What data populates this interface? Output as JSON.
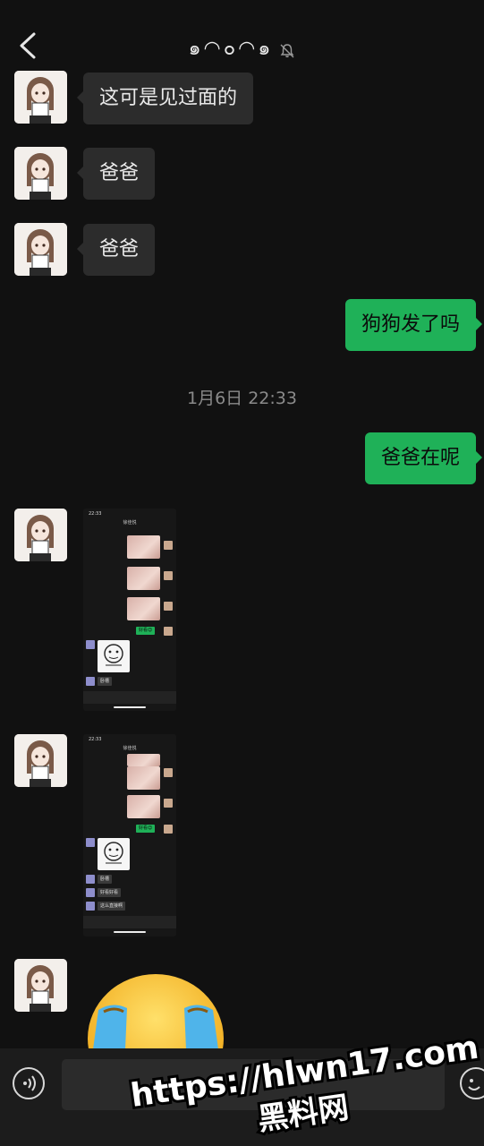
{
  "header": {
    "title": "๑◠๐◠๑",
    "icons": {
      "back": "back-icon",
      "mute": "bell-slash-icon"
    }
  },
  "messages": [
    {
      "side": "in",
      "text": "这可是见过面的"
    },
    {
      "side": "in",
      "text": "爸爸"
    },
    {
      "side": "in",
      "text": "爸爸"
    },
    {
      "side": "out",
      "text": "狗狗发了吗"
    },
    {
      "side": "out",
      "text": "爸爸在呢"
    }
  ],
  "timestamp": "1月6日 22:33",
  "screenshot1": {
    "time": "22:33",
    "title": "徐佳悦",
    "green_reply": "好看😊",
    "small_msgs": [
      "卧槽"
    ]
  },
  "screenshot2": {
    "time": "22:33",
    "title": "徐佳悦",
    "green_reply": "好看😊",
    "small_msgs": [
      "卧槽",
      "好看好看",
      "这么直接啊"
    ]
  },
  "input": {
    "placeholder": ""
  },
  "watermark": {
    "line1": "https://hlwn17.com",
    "line2": "黑料网"
  },
  "colors": {
    "background": "#111111",
    "incoming_bubble": "#2c2c2c",
    "outgoing_bubble": "#1fb158",
    "timestamp": "#8a8a8a"
  }
}
